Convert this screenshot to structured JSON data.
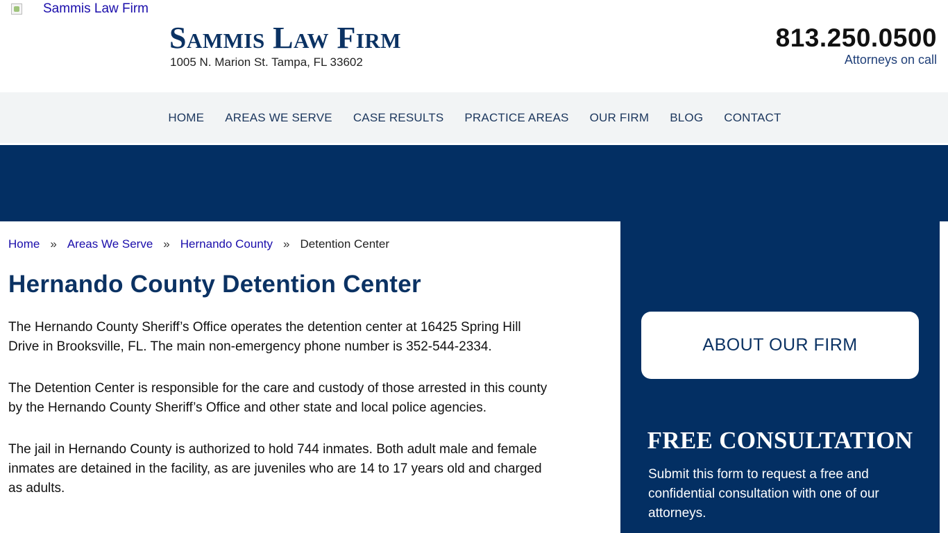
{
  "header": {
    "logo_alt": "Sammis Law Firm",
    "brand_title": "Sammis Law Firm",
    "address": "1005 N. Marion St. Tampa, FL 33602",
    "phone": "813.250.0500",
    "phone_caption": "Attorneys on call"
  },
  "nav": {
    "items": [
      {
        "label": "HOME"
      },
      {
        "label": "AREAS WE SERVE"
      },
      {
        "label": "CASE RESULTS"
      },
      {
        "label": "PRACTICE AREAS"
      },
      {
        "label": "OUR FIRM"
      },
      {
        "label": "BLOG"
      },
      {
        "label": "CONTACT"
      }
    ]
  },
  "breadcrumb": {
    "items": [
      "Home",
      "Areas We Serve",
      "Hernando County"
    ],
    "separator": "»",
    "current": "Detention Center"
  },
  "main": {
    "title": "Hernando County Detention Center",
    "paragraphs": [
      "The Hernando County Sheriff’s Office operates the detention center at 16425 Spring Hill Drive in Brooksville, FL. The main non-emergency phone number is 352-544-2334.",
      "The Detention Center is responsible for the care and custody of those arrested in this county by the Hernando County Sheriff’s Office and other state and local police agencies.",
      "The jail in Hernando County is authorized to hold 744 inmates. Both adult male and female inmates are detained in the facility, as are juveniles who are 14 to 17 years old and charged as adults."
    ]
  },
  "sidebar": {
    "about_label": "ABOUT OUR FIRM",
    "consult_title": "FREE CONSULTATION",
    "consult_text": "Submit this form to request a free and confidential consultation with one of our attorneys."
  },
  "colors": {
    "brand_navy": "#032f63",
    "title_navy": "#0b3263",
    "nav_bg": "#f2f4f5",
    "link": "#1a0dab"
  }
}
